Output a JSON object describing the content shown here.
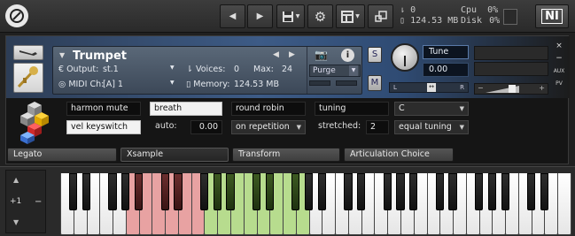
{
  "toolbar": {
    "logo_icon": "kontakt-logo-icon",
    "prev_icon": "arrow-left-icon",
    "next_icon": "arrow-right-icon",
    "save_icon": "disk-save-icon",
    "options_icon": "gear-icon",
    "view_icon": "layout-icon",
    "minimize_icon": "minimize-icon",
    "voices_icon": "voices-icon",
    "voices": "0",
    "memory_icon": "memory-icon",
    "memory": "124.53 MB",
    "cpu_label": "Cpu",
    "cpu": "0%",
    "disk_label": "Disk",
    "disk": "0%",
    "ni_logo": "NI"
  },
  "instrument": {
    "wrench_icon": "wrench-icon",
    "instrument_icon": "trumpet-icon",
    "expand_icon": "triangle-down-icon",
    "name": "Trumpet",
    "prev_icon": "chevron-left-icon",
    "next_icon": "chevron-right-icon",
    "camera_icon": "camera-icon",
    "info_icon": "info-icon",
    "output_label": "Output:",
    "output_value": "st.1",
    "voices_label": "Voices:",
    "voices_value": "0",
    "max_label": "Max:",
    "max_value": "24",
    "purge_label": "Purge",
    "midi_label": "MIDI Ch:",
    "midi_value": "[A] 1",
    "memory_label": "Memory:",
    "memory_value": "124.53 MB",
    "solo_label": "S",
    "mute_label": "M",
    "tune_label": "Tune",
    "tune_value": "0.00",
    "pan_left": "L",
    "pan_right": "R",
    "vol_minus": "−",
    "vol_plus": "+",
    "close_label": "×",
    "min_label": "−",
    "aux_label": "AUX",
    "pv_label": "PV"
  },
  "articulation": {
    "logo_icon": "cubes-logo-icon",
    "harmon_mute": "harmon mute",
    "breath": "breath",
    "round_robin": "round robin",
    "tuning": "tuning",
    "key_select": "C",
    "vel_keyswitch": "vel keyswitch",
    "auto_label": "auto:",
    "auto_value": "0.00",
    "repetition_select": "on repetition",
    "stretched_label": "stretched:",
    "stretched_value": "2",
    "tuning_select": "equal tuning"
  },
  "tabs": [
    "Legato",
    "Xsample",
    "Transform",
    "Articulation Choice"
  ],
  "keyboard": {
    "octave_up_icon": "triangle-up-icon",
    "octave_down_icon": "triangle-down-icon",
    "octave_value": "+1",
    "octave_minus": "−",
    "keyswitch_color": "#e8a2a2",
    "keyswitch_range_keys": [
      5,
      6,
      7,
      8,
      9,
      10
    ],
    "playable_color": "#b7dc8e",
    "playable_range_keys": [
      11,
      12,
      13,
      14,
      15,
      16,
      17,
      18
    ],
    "white_key_count": 39
  },
  "colors": {
    "panel_blue": "#3d5b86",
    "selected_field": "#f2f2f2"
  }
}
